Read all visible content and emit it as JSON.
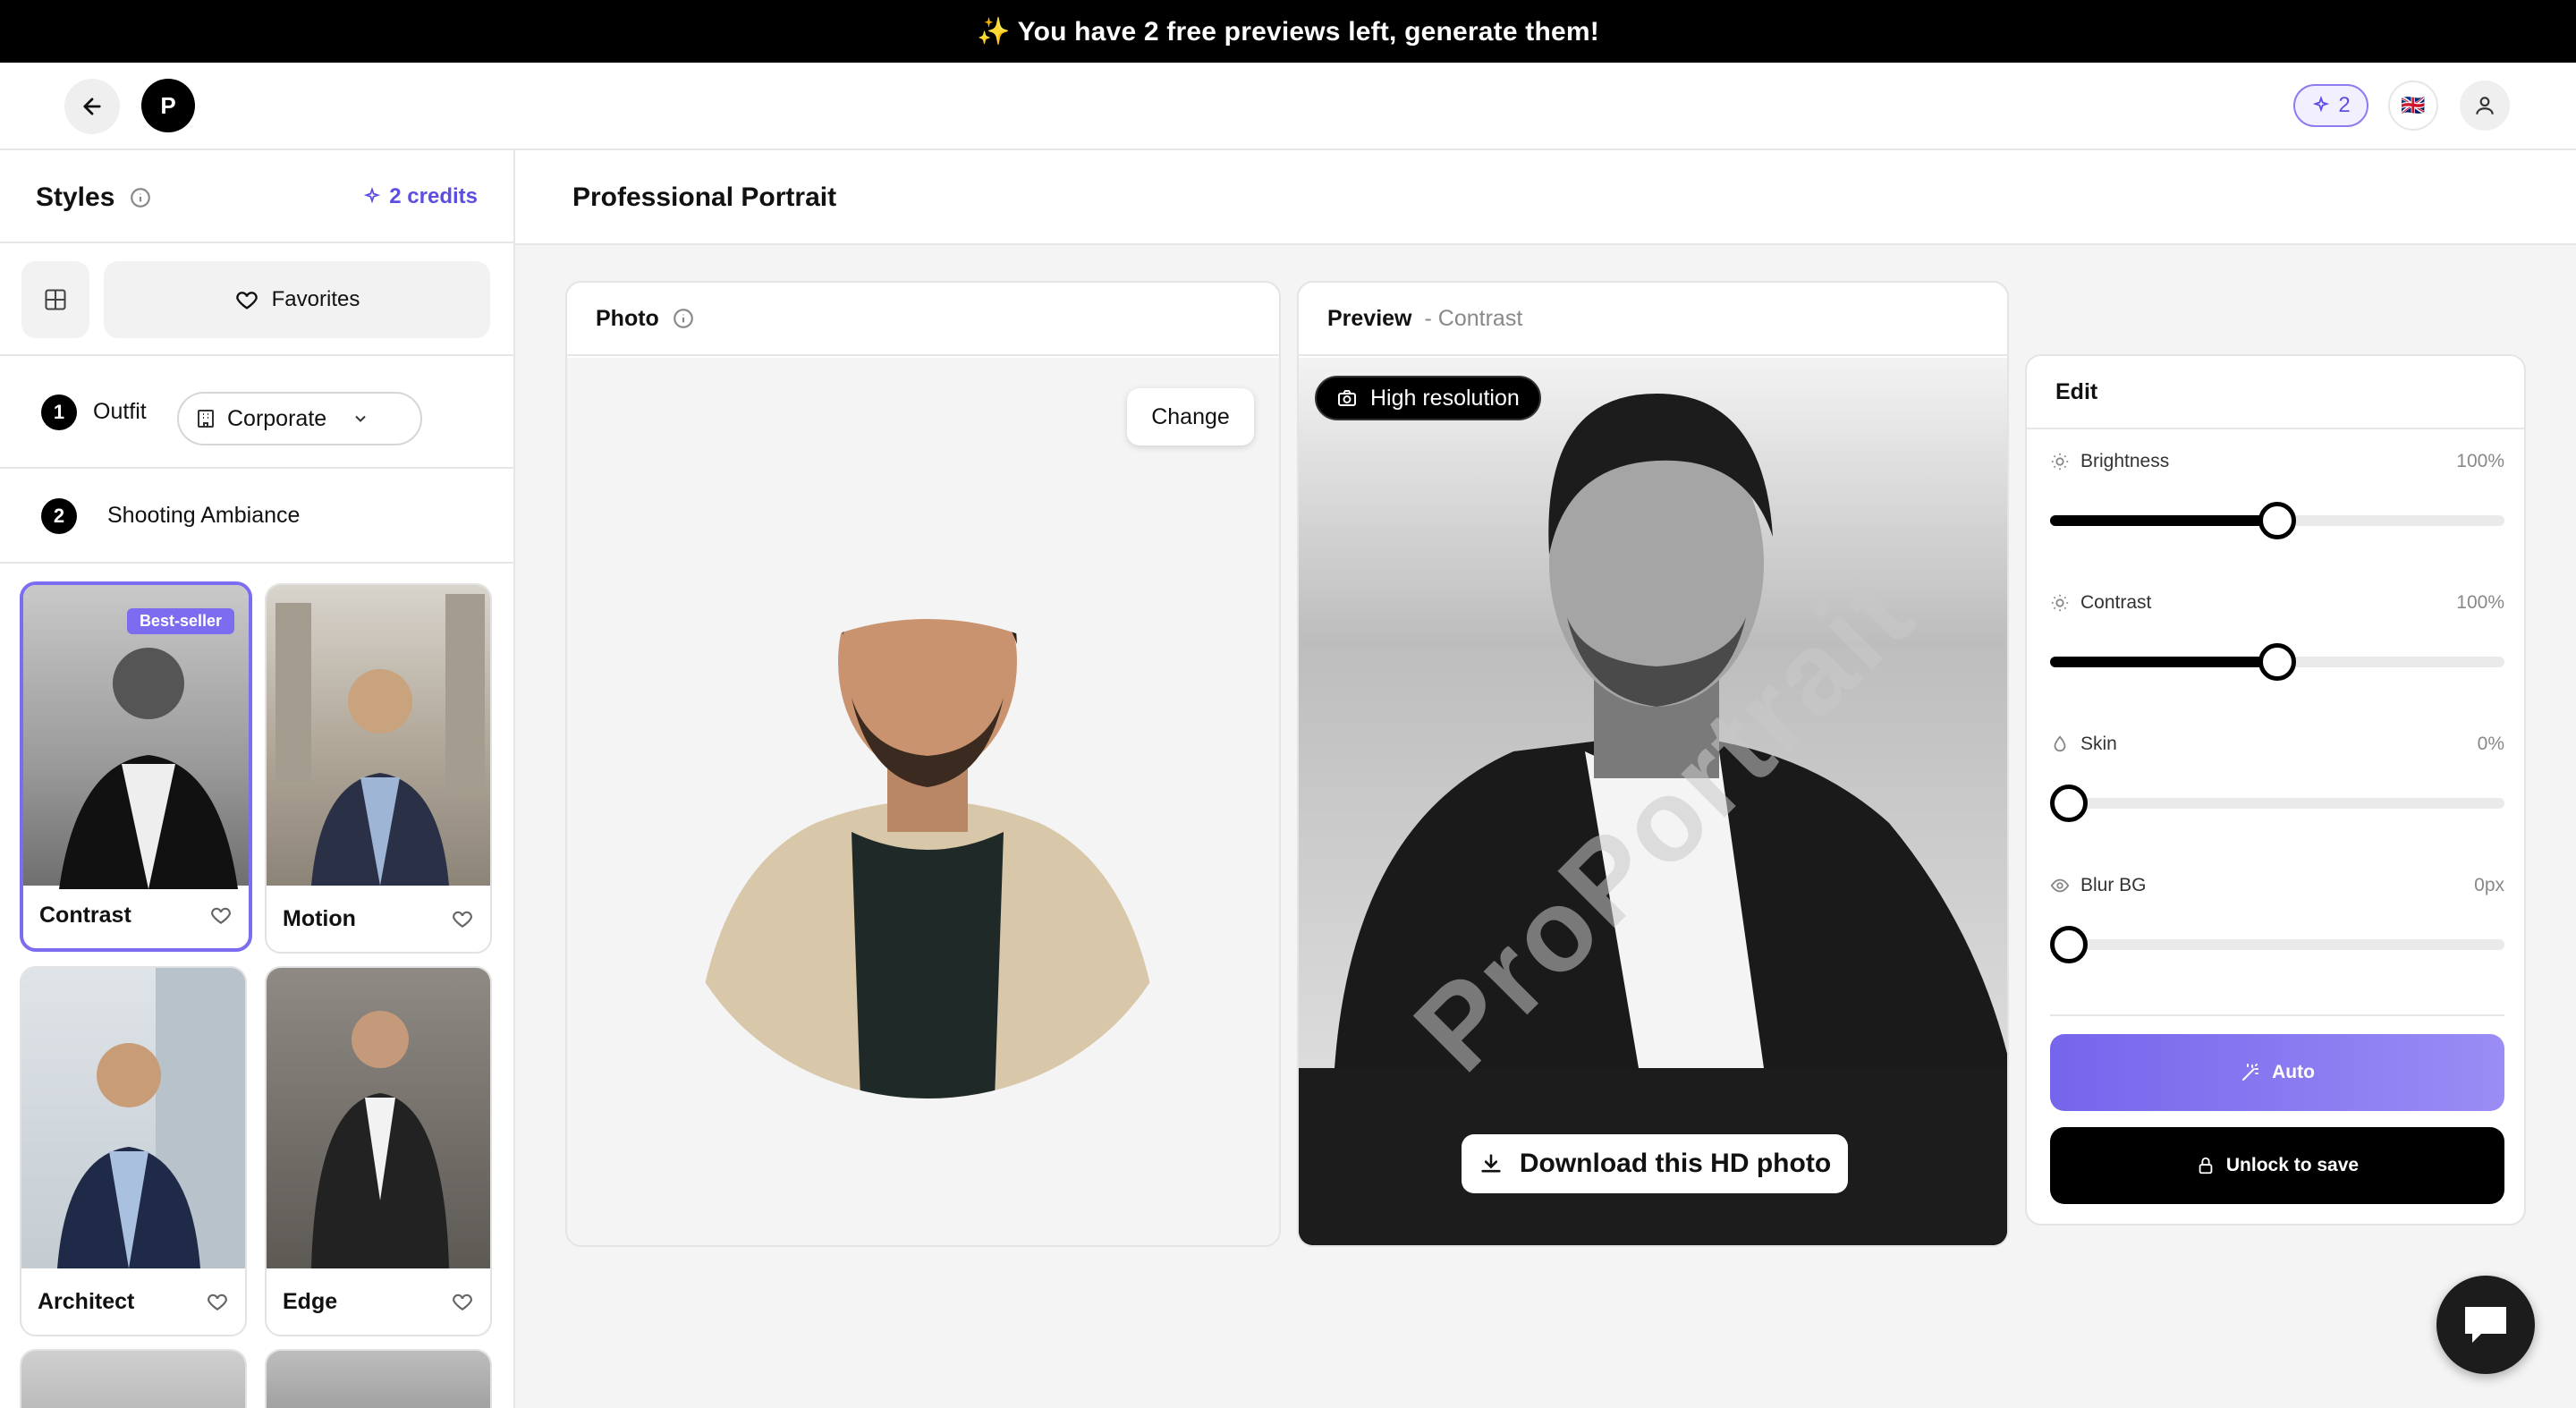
{
  "banner": {
    "text": "✨ You have 2 free previews left, generate them!"
  },
  "header": {
    "logo_letter": "P",
    "credits_count": "2",
    "language_flag": "🇬🇧"
  },
  "sidebar": {
    "title": "Styles",
    "credits": "2 credits",
    "favorites_label": "Favorites",
    "step1": {
      "number": "1",
      "label": "Outfit",
      "selected_outfit": "Corporate"
    },
    "step2": {
      "number": "2",
      "label": "Shooting Ambiance"
    },
    "styles": [
      {
        "name": "Contrast",
        "badge": "Best-seller",
        "selected": true
      },
      {
        "name": "Motion"
      },
      {
        "name": "Architect"
      },
      {
        "name": "Edge"
      }
    ]
  },
  "main": {
    "title": "Professional Portrait",
    "photo": {
      "title": "Photo",
      "change_label": "Change"
    },
    "preview": {
      "title": "Preview",
      "style_suffix": "- Contrast",
      "badge": "High resolution",
      "watermark": "ProPortrait",
      "download_label": "Download this HD photo"
    },
    "edit": {
      "title": "Edit",
      "sliders": [
        {
          "label": "Brightness",
          "value": "100%",
          "level": 0.5,
          "icon": "sun-icon"
        },
        {
          "label": "Contrast",
          "value": "100%",
          "level": 0.5,
          "icon": "sun-icon"
        },
        {
          "label": "Skin",
          "value": "0%",
          "level": 0,
          "icon": "drop-icon"
        },
        {
          "label": "Blur BG",
          "value": "0px",
          "level": 0,
          "icon": "eye-icon"
        }
      ],
      "auto_label": "Auto",
      "unlock_label": "Unlock to save"
    }
  },
  "colors": {
    "accent": "#7b6cf0",
    "banner_bg": "#000000"
  }
}
